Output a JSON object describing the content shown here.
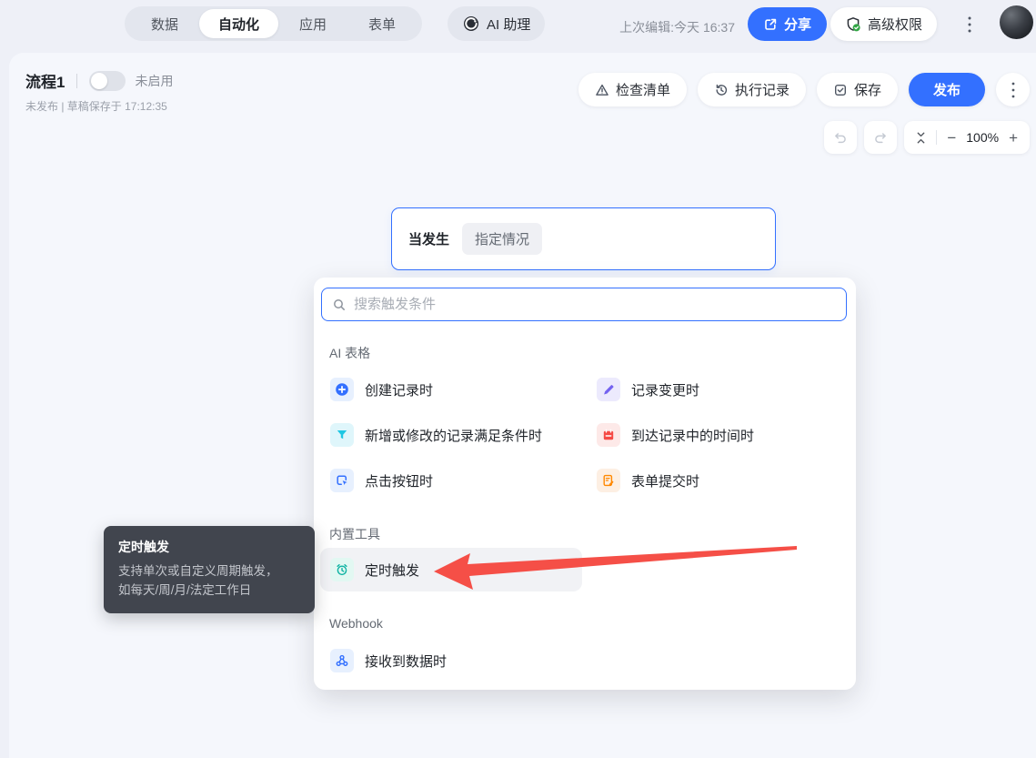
{
  "topbar": {
    "tabs": [
      {
        "label": "数据",
        "active": false
      },
      {
        "label": "自动化",
        "active": true
      },
      {
        "label": "应用",
        "active": false
      },
      {
        "label": "表单",
        "active": false
      }
    ],
    "ai_assistant_label": "AI 助理",
    "last_edited": "上次编辑:今天 16:37",
    "share_label": "分享",
    "advanced_permission_label": "高级权限"
  },
  "flow_header": {
    "title": "流程1",
    "enabled_label": "未启用",
    "status_line": "未发布 | 草稿保存于 17:12:35"
  },
  "toolbar": {
    "checklist_label": "检查清单",
    "run_history_label": "执行记录",
    "save_label": "保存",
    "publish_label": "发布"
  },
  "zoombar": {
    "minus": "−",
    "zoom_level": "100%",
    "plus": "+"
  },
  "trigger_node": {
    "prefix_label": "当发生",
    "condition_chip": "指定情况"
  },
  "dropdown": {
    "search_placeholder": "搜索触发条件",
    "section_ai_table": {
      "title": "AI 表格",
      "items": [
        {
          "label": "创建记录时",
          "icon": "plus-circle-icon"
        },
        {
          "label": "记录变更时",
          "icon": "pencil-icon"
        },
        {
          "label": "新增或修改的记录满足条件时",
          "icon": "filter-icon"
        },
        {
          "label": "到达记录中的时间时",
          "icon": "calendar-icon"
        },
        {
          "label": "点击按钮时",
          "icon": "button-click-icon"
        },
        {
          "label": "表单提交时",
          "icon": "form-icon"
        }
      ]
    },
    "section_builtin": {
      "title": "内置工具",
      "items": [
        {
          "label": "定时触发",
          "icon": "alarm-clock-icon",
          "highlighted": true
        }
      ]
    },
    "section_webhook": {
      "title": "Webhook",
      "items": [
        {
          "label": "接收到数据时",
          "icon": "webhook-icon"
        }
      ]
    }
  },
  "tooltip": {
    "title": "定时触发",
    "description_line1": "支持单次或自定义周期触发，",
    "description_line2": "如每天/周/月/法定工作日"
  },
  "icons": {
    "share": "share-arrow",
    "advanced_permission": "shield-check",
    "more": "vertical-dots",
    "checklist": "warning-triangle",
    "run_history": "history-clock",
    "save": "check-square",
    "undo": "undo-arrow",
    "redo": "redo-arrow",
    "fit": "fit-view",
    "search": "magnifier",
    "ai_assistant": "dark-circle-logo"
  },
  "colors": {
    "accent_blue": "#3370ff",
    "danger_red": "#f5483f",
    "teal": "#10b3a3",
    "purple": "#7463f0",
    "cyan": "#1fc7e3",
    "orange": "#ff8800",
    "green_check": "#32a645",
    "tooltip_bg": "#41454e"
  }
}
